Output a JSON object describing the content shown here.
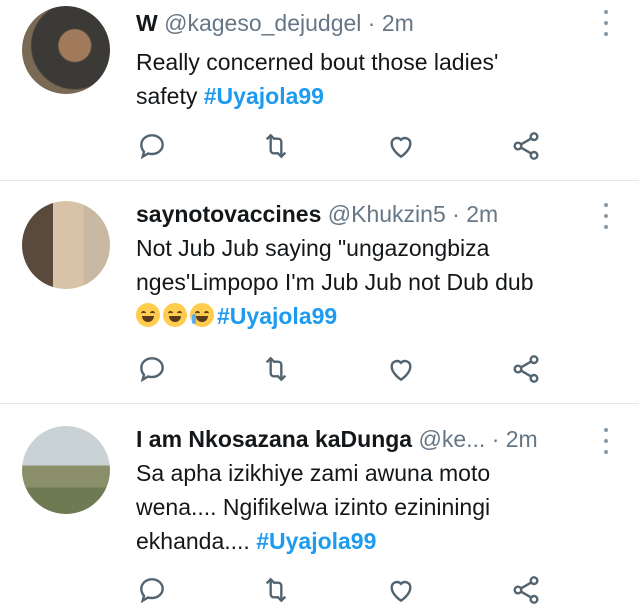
{
  "tweets": [
    {
      "name": "W",
      "handle": "@kageso_dejudgel",
      "dot": "·",
      "time": "2m",
      "line1": "Really concerned bout those ladies'",
      "line2": "safety ",
      "hashtag": "#Uyajola99",
      "avatar_colors": [
        "#3b3a36",
        "#7a6a55"
      ]
    },
    {
      "name": "saynotovaccines",
      "handle": "@Khukzin5",
      "dot": "·",
      "time": "2m",
      "line1": "Not Jub Jub saying \"ungazongbiza",
      "line2": "nges'Limpopo I'm Jub Jub not Dub dub",
      "emojis": [
        "face-with-tears-of-joy",
        "grinning-face-with-sweat",
        "loudly-crying-face"
      ],
      "hashtag": "#Uyajola99",
      "avatar_colors": [
        "#c9b9a3",
        "#5a4a3c"
      ]
    },
    {
      "name": "I am Nkosazana kaDunga",
      "handle": "@ke...",
      "dot": "·",
      "time": "2m",
      "line1": "Sa apha izikhiye zami awuna moto",
      "line2": "wena.... Ngifikelwa izinto ezininingi",
      "line3": "ekhanda.... ",
      "hashtag": "#Uyajola99",
      "avatar_colors": [
        "#b7c6c9",
        "#6d7a52"
      ]
    }
  ],
  "icons": [
    "reply-icon",
    "retweet-icon",
    "like-icon",
    "share-icon",
    "more-icon"
  ],
  "colors": {
    "hashtag": "#1d9bf0",
    "secondary": "#657786",
    "divider": "#e1e8ed"
  }
}
